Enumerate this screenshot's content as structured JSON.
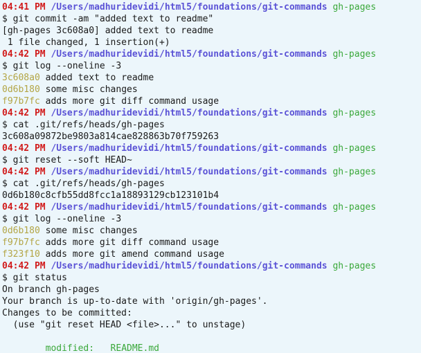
{
  "prompt": {
    "path": "/Users/madhuridevidi/html5/foundations/git-commands",
    "branch": "gh-pages",
    "symbol": "$"
  },
  "lines": [
    {
      "kind": "prompt",
      "time": "04:41 PM"
    },
    {
      "kind": "cmd",
      "text": "$ git commit -am \"added text to readme\""
    },
    {
      "kind": "out",
      "text": "[gh-pages 3c608a0] added text to readme"
    },
    {
      "kind": "out",
      "text": " 1 file changed, 1 insertion(+)"
    },
    {
      "kind": "prompt",
      "time": "04:42 PM"
    },
    {
      "kind": "cmd",
      "text": "$ git log --oneline -3"
    },
    {
      "kind": "log",
      "hash": "3c608a0",
      "text": " added text to readme"
    },
    {
      "kind": "log",
      "hash": "0d6b180",
      "text": " some misc changes"
    },
    {
      "kind": "log",
      "hash": "f97b7fc",
      "text": " adds more git diff command usage"
    },
    {
      "kind": "prompt",
      "time": "04:42 PM"
    },
    {
      "kind": "cmd",
      "text": "$ cat .git/refs/heads/gh-pages"
    },
    {
      "kind": "out",
      "text": "3c608a09872be9803a814cae828863b70f759263"
    },
    {
      "kind": "prompt",
      "time": "04:42 PM"
    },
    {
      "kind": "cmd",
      "text": "$ git reset --soft HEAD~"
    },
    {
      "kind": "prompt",
      "time": "04:42 PM"
    },
    {
      "kind": "cmd",
      "text": "$ cat .git/refs/heads/gh-pages"
    },
    {
      "kind": "out",
      "text": "0d6b180c8cfb55dd8fcc1a18893129cb123101b4"
    },
    {
      "kind": "prompt",
      "time": "04:42 PM"
    },
    {
      "kind": "cmd",
      "text": "$ git log --oneline -3"
    },
    {
      "kind": "log",
      "hash": "0d6b180",
      "text": " some misc changes"
    },
    {
      "kind": "log",
      "hash": "f97b7fc",
      "text": " adds more git diff command usage"
    },
    {
      "kind": "log",
      "hash": "f323f10",
      "text": " adds more git amend command usage"
    },
    {
      "kind": "prompt",
      "time": "04:42 PM"
    },
    {
      "kind": "cmd",
      "text": "$ git status"
    },
    {
      "kind": "out",
      "text": "On branch gh-pages"
    },
    {
      "kind": "out",
      "text": "Your branch is up-to-date with 'origin/gh-pages'."
    },
    {
      "kind": "out",
      "text": "Changes to be committed:"
    },
    {
      "kind": "out",
      "text": "  (use \"git reset HEAD <file>...\" to unstage)"
    },
    {
      "kind": "blank"
    },
    {
      "kind": "modified",
      "label": "        modified:   ",
      "file": "README.md"
    }
  ]
}
